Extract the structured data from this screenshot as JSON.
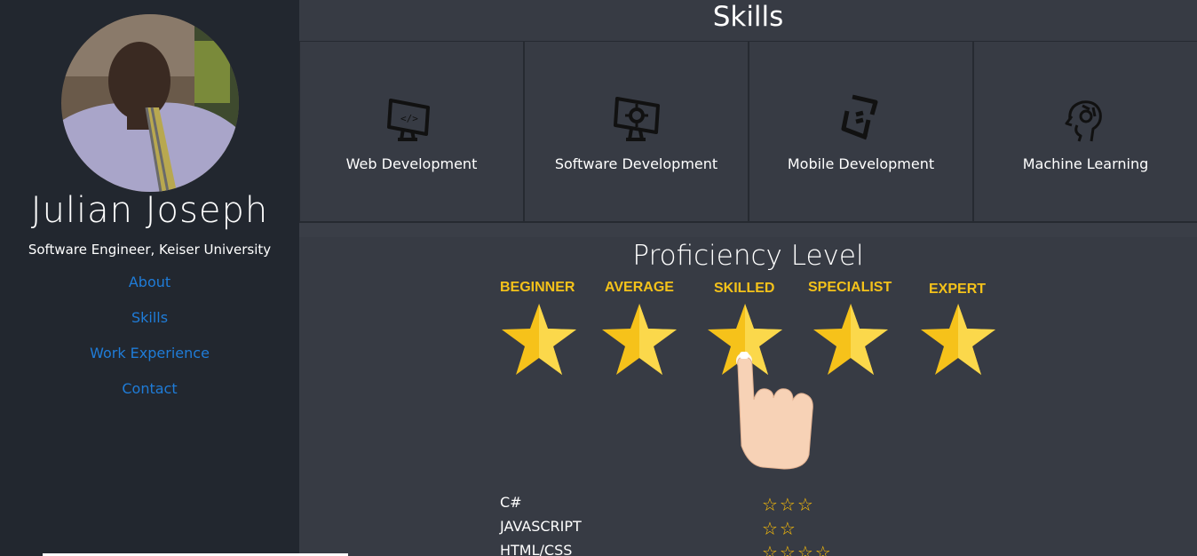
{
  "profile": {
    "name": "Julian Joseph",
    "tagline": "Software Engineer, Keiser University"
  },
  "nav": [
    "About",
    "Skills",
    "Work Experience",
    "Contact"
  ],
  "skills": {
    "title": "Skills",
    "items": [
      {
        "label": "Web Development",
        "icon": "web-development-icon"
      },
      {
        "label": "Software Development",
        "icon": "software-development-icon"
      },
      {
        "label": "Mobile Development",
        "icon": "mobile-development-icon"
      },
      {
        "label": "Machine Learning",
        "icon": "machine-learning-icon"
      }
    ]
  },
  "proficiency": {
    "title": "Proficiency Level",
    "levels": [
      "BEGINNER",
      "AVERAGE",
      "SKILLED",
      "SPECIALIST",
      "EXPERT"
    ],
    "rows": [
      {
        "skill": "C#",
        "stars": 3,
        "stars_text": "☆☆☆"
      },
      {
        "skill": "JAVASCRIPT",
        "stars": 2,
        "stars_text": "☆☆"
      },
      {
        "skill": "HTML/CSS",
        "stars": 4,
        "stars_text": "☆☆☆☆"
      }
    ]
  },
  "colors": {
    "sidebar": "#22272f",
    "main": "#373b44",
    "link": "#1f7cd8",
    "star": "#ffc107",
    "level_label": "#f4c21a"
  }
}
